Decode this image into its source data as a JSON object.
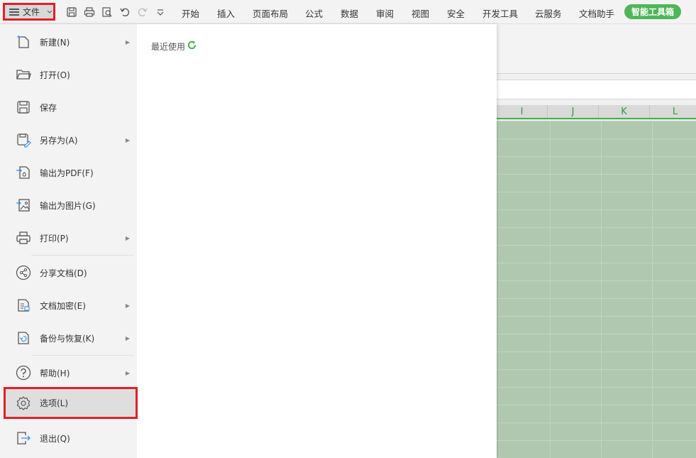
{
  "topbar": {
    "file_label": "文件",
    "tabs": [
      "开始",
      "插入",
      "页面布局",
      "公式",
      "数据",
      "审阅",
      "视图",
      "安全",
      "开发工具",
      "云服务",
      "文档助手"
    ],
    "smart_toolbox": "智能工具箱"
  },
  "sheet": {
    "columns": [
      "I",
      "J",
      "K",
      "L"
    ],
    "accent_color": "#3fae49",
    "grid_color": "#b0c8b0"
  },
  "file_menu": {
    "items": [
      {
        "label": "新建(N)",
        "icon": "new-file-icon",
        "submenu": true
      },
      {
        "label": "打开(O)",
        "icon": "folder-open-icon",
        "submenu": false
      },
      {
        "label": "保存",
        "icon": "save-icon",
        "submenu": false
      },
      {
        "label": "另存为(A)",
        "icon": "save-as-icon",
        "submenu": true
      },
      {
        "label": "输出为PDF(F)",
        "icon": "export-pdf-icon",
        "submenu": false
      },
      {
        "label": "输出为图片(G)",
        "icon": "export-image-icon",
        "submenu": false
      },
      {
        "label": "打印(P)",
        "icon": "printer-icon",
        "submenu": true
      },
      {
        "label": "分享文档(D)",
        "icon": "share-icon",
        "submenu": false
      },
      {
        "label": "文档加密(E)",
        "icon": "document-encrypt-icon",
        "submenu": true
      },
      {
        "label": "备份与恢复(K)",
        "icon": "backup-restore-icon",
        "submenu": true
      },
      {
        "label": "帮助(H)",
        "icon": "help-icon",
        "submenu": true
      },
      {
        "label": "选项(L)",
        "icon": "gear-icon",
        "submenu": false
      },
      {
        "label": "退出(Q)",
        "icon": "exit-icon",
        "submenu": false
      }
    ],
    "selected": "选项(L)",
    "highlight_color": "#e0202a"
  },
  "recent": {
    "label": "最近使用",
    "icon": "refresh-icon"
  }
}
